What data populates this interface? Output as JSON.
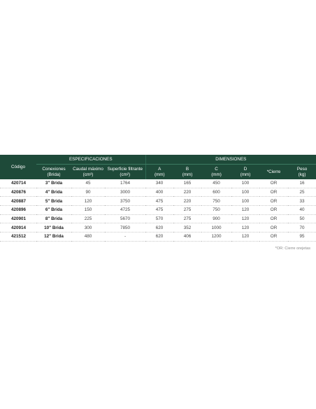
{
  "table": {
    "header": {
      "codigo": "Código",
      "especificaciones": "ESPECIFICACIONES",
      "dimensiones": "DIMENSIONES",
      "columns": [
        {
          "label": "Conexiones",
          "unit": "(Brida)"
        },
        {
          "label": "Caudal máximo",
          "unit": "(cm³)"
        },
        {
          "label": "Superficie filtrante",
          "unit": "(cm²)"
        },
        {
          "label": "A",
          "unit": "(mm)"
        },
        {
          "label": "B",
          "unit": "(mm)"
        },
        {
          "label": "C",
          "unit": "(mm)"
        },
        {
          "label": "D",
          "unit": "(mm)"
        },
        {
          "label": "*Cierre",
          "unit": ""
        },
        {
          "label": "Peso",
          "unit": "(kg)"
        }
      ]
    },
    "rows": [
      {
        "code": "420714",
        "conn": "3\" Brida",
        "caudal": "45",
        "superficie": "1764",
        "a": "340",
        "b": "165",
        "c": "450",
        "d": "100",
        "cierre": "OR",
        "peso": "16"
      },
      {
        "code": "420876",
        "conn": "4\" Brida",
        "caudal": "90",
        "superficie": "3000",
        "a": "400",
        "b": "220",
        "c": "600",
        "d": "100",
        "cierre": "OR",
        "peso": "25"
      },
      {
        "code": "420887",
        "conn": "5\" Brida",
        "caudal": "120",
        "superficie": "3750",
        "a": "475",
        "b": "220",
        "c": "750",
        "d": "100",
        "cierre": "OR",
        "peso": "33"
      },
      {
        "code": "420896",
        "conn": "6\" Brida",
        "caudal": "150",
        "superficie": "4725",
        "a": "475",
        "b": "275",
        "c": "750",
        "d": "120",
        "cierre": "OR",
        "peso": "40"
      },
      {
        "code": "420901",
        "conn": "8\" Brida",
        "caudal": "225",
        "superficie": "5670",
        "a": "570",
        "b": "275",
        "c": "900",
        "d": "120",
        "cierre": "OR",
        "peso": "50"
      },
      {
        "code": "420914",
        "conn": "10\" Brida",
        "caudal": "300",
        "superficie": "7850",
        "a": "620",
        "b": "352",
        "c": "1000",
        "d": "120",
        "cierre": "OR",
        "peso": "70"
      },
      {
        "code": "421512",
        "conn": "12\" Brida",
        "caudal": "480",
        "superficie": "-",
        "a": "620",
        "b": "406",
        "c": "1200",
        "d": "120",
        "cierre": "OR",
        "peso": "95"
      }
    ],
    "footnote": "*OR: Cierre orejetas"
  },
  "colors": {
    "header_bg": "#1e4a39",
    "header_text": "#ffffff"
  }
}
